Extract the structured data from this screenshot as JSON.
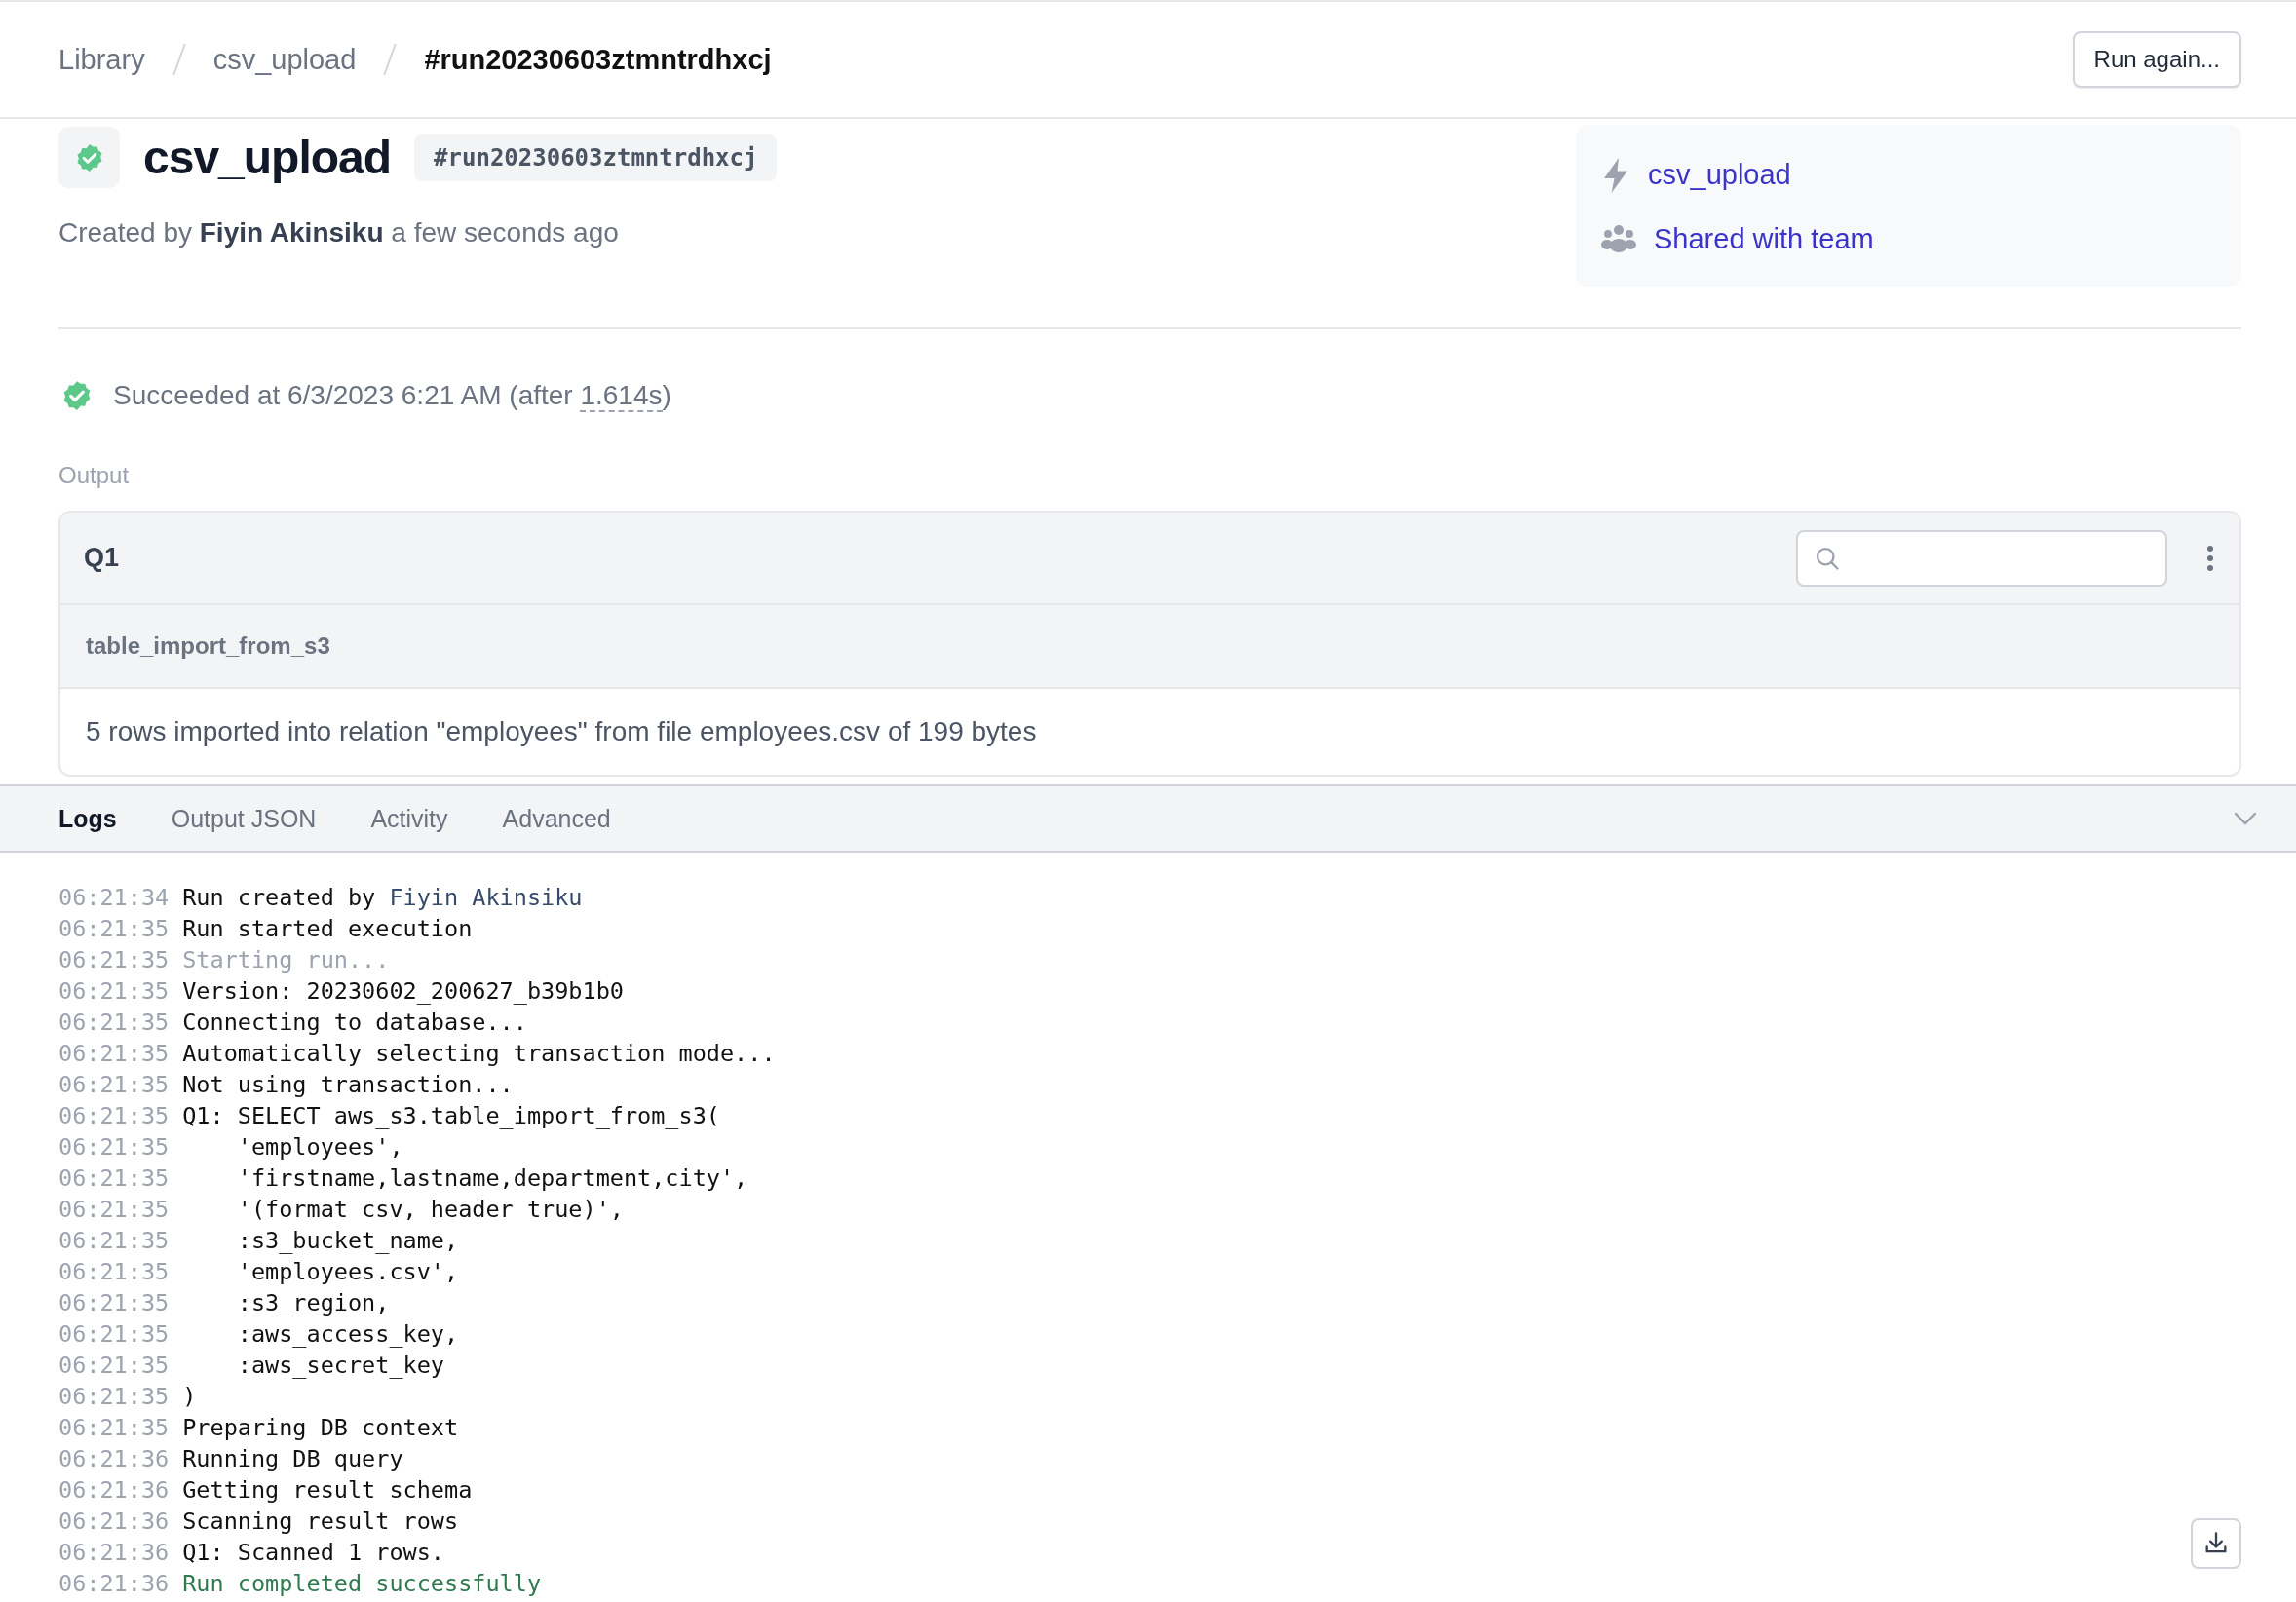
{
  "breadcrumb": [
    {
      "label": "Library",
      "current": false
    },
    {
      "label": "csv_upload",
      "current": false
    },
    {
      "label": "#run20230603ztmntrdhxcj",
      "current": true
    }
  ],
  "run_again_button": "Run again...",
  "run": {
    "succeeded": true,
    "title": "csv_upload",
    "run_id": "#run20230603ztmntrdhxcj",
    "created_prefix": "Created by",
    "creator": "Fiyin Akinsiku",
    "created_suffix": "a few seconds ago"
  },
  "info_panel": {
    "task_link": "csv_upload",
    "sharing_link": "Shared with team"
  },
  "result": {
    "text": "Succeeded at 6/3/2023 6:21 AM (after ",
    "duration": "1.614s",
    "suffix": ")"
  },
  "output": {
    "label": "Output",
    "query": "Q1",
    "column": "table_import_from_s3",
    "rows": [
      "5 rows imported into relation \"employees\" from file employees.csv of 199 bytes"
    ]
  },
  "tabs": [
    {
      "label": "Logs",
      "selected": true
    },
    {
      "label": "Output JSON",
      "selected": false
    },
    {
      "label": "Activity",
      "selected": false
    },
    {
      "label": "Advanced",
      "selected": false
    }
  ],
  "logs": [
    {
      "time": "06:21:34",
      "text": "Run created by ",
      "actor": "Fiyin Akinsiku",
      "kind": "normal"
    },
    {
      "time": "06:21:35",
      "text": "Run started execution",
      "kind": "normal"
    },
    {
      "time": "06:21:35",
      "text": "Starting run...",
      "kind": "muted"
    },
    {
      "time": "06:21:35",
      "text": "Version: 20230602_200627_b39b1b0",
      "kind": "normal"
    },
    {
      "time": "06:21:35",
      "text": "Connecting to database...",
      "kind": "normal"
    },
    {
      "time": "06:21:35",
      "text": "Automatically selecting transaction mode...",
      "kind": "normal"
    },
    {
      "time": "06:21:35",
      "text": "Not using transaction...",
      "kind": "normal"
    },
    {
      "time": "06:21:35",
      "text": "Q1: SELECT aws_s3.table_import_from_s3(",
      "kind": "normal"
    },
    {
      "time": "06:21:35",
      "text": "    'employees',",
      "kind": "normal"
    },
    {
      "time": "06:21:35",
      "text": "    'firstname,lastname,department,city',",
      "kind": "normal"
    },
    {
      "time": "06:21:35",
      "text": "    '(format csv, header true)',",
      "kind": "normal"
    },
    {
      "time": "06:21:35",
      "text": "    :s3_bucket_name,",
      "kind": "normal"
    },
    {
      "time": "06:21:35",
      "text": "    'employees.csv',",
      "kind": "normal"
    },
    {
      "time": "06:21:35",
      "text": "    :s3_region,",
      "kind": "normal"
    },
    {
      "time": "06:21:35",
      "text": "    :aws_access_key,",
      "kind": "normal"
    },
    {
      "time": "06:21:35",
      "text": "    :aws_secret_key",
      "kind": "normal"
    },
    {
      "time": "06:21:35",
      "text": ")",
      "kind": "normal"
    },
    {
      "time": "06:21:35",
      "text": "Preparing DB context",
      "kind": "normal"
    },
    {
      "time": "06:21:36",
      "text": "Running DB query",
      "kind": "normal"
    },
    {
      "time": "06:21:36",
      "text": "Getting result schema",
      "kind": "normal"
    },
    {
      "time": "06:21:36",
      "text": "Scanning result rows",
      "kind": "normal"
    },
    {
      "time": "06:21:36",
      "text": "Q1: Scanned 1 rows.",
      "kind": "normal"
    },
    {
      "time": "06:21:36",
      "text": "Run completed successfully",
      "kind": "success"
    }
  ]
}
